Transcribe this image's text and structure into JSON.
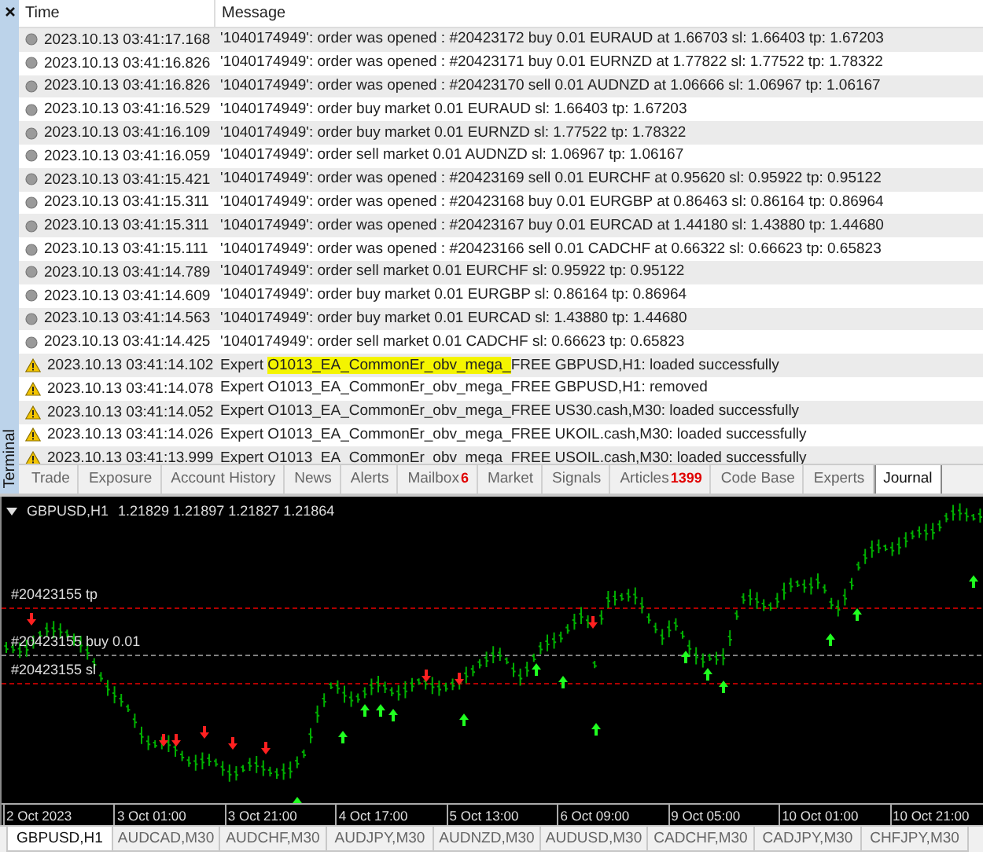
{
  "terminal": {
    "title": "Terminal"
  },
  "journal": {
    "columns": [
      "Time",
      "Message"
    ],
    "rows": [
      {
        "kind": "info",
        "time": "2023.10.13 03:41:17.168",
        "segments": [
          {
            "text": "'1040174949': order was opened : #20423172 buy 0.01 EURAUD at 1.66703 sl: 1.66403 tp: 1.67203",
            "highlighted": false
          }
        ]
      },
      {
        "kind": "info",
        "time": "2023.10.13 03:41:16.826",
        "segments": [
          {
            "text": "'1040174949': order was opened : #20423171 buy 0.01 EURNZD at 1.77822 sl: 1.77522 tp: 1.78322",
            "highlighted": false
          }
        ]
      },
      {
        "kind": "info",
        "time": "2023.10.13 03:41:16.826",
        "segments": [
          {
            "text": "'1040174949': order was opened : #20423170 sell 0.01 AUDNZD at 1.06666 sl: 1.06967 tp: 1.06167",
            "highlighted": false
          }
        ]
      },
      {
        "kind": "info",
        "time": "2023.10.13 03:41:16.529",
        "segments": [
          {
            "text": "'1040174949': order buy market 0.01 EURAUD sl: 1.66403 tp: 1.67203",
            "highlighted": false
          }
        ]
      },
      {
        "kind": "info",
        "time": "2023.10.13 03:41:16.109",
        "segments": [
          {
            "text": "'1040174949': order buy market 0.01 EURNZD sl: 1.77522 tp: 1.78322",
            "highlighted": false
          }
        ]
      },
      {
        "kind": "info",
        "time": "2023.10.13 03:41:16.059",
        "segments": [
          {
            "text": "'1040174949': order sell market 0.01 AUDNZD sl: 1.06967 tp: 1.06167",
            "highlighted": false
          }
        ]
      },
      {
        "kind": "info",
        "time": "2023.10.13 03:41:15.421",
        "segments": [
          {
            "text": "'1040174949': order was opened : #20423169 sell 0.01 EURCHF at 0.95620 sl: 0.95922 tp: 0.95122",
            "highlighted": false
          }
        ]
      },
      {
        "kind": "info",
        "time": "2023.10.13 03:41:15.311",
        "segments": [
          {
            "text": "'1040174949': order was opened : #20423168 buy 0.01 EURGBP at 0.86463 sl: 0.86164 tp: 0.86964",
            "highlighted": false
          }
        ]
      },
      {
        "kind": "info",
        "time": "2023.10.13 03:41:15.311",
        "segments": [
          {
            "text": "'1040174949': order was opened : #20423167 buy 0.01 EURCAD at 1.44180 sl: 1.43880 tp: 1.44680",
            "highlighted": false
          }
        ]
      },
      {
        "kind": "info",
        "time": "2023.10.13 03:41:15.111",
        "segments": [
          {
            "text": "'1040174949': order was opened : #20423166 sell 0.01 CADCHF at 0.66322 sl: 0.66623 tp: 0.65823",
            "highlighted": false
          }
        ]
      },
      {
        "kind": "info",
        "time": "2023.10.13 03:41:14.789",
        "segments": [
          {
            "text": "'1040174949': order sell market 0.01 EURCHF sl: 0.95922 tp: 0.95122",
            "highlighted": false
          }
        ]
      },
      {
        "kind": "info",
        "time": "2023.10.13 03:41:14.609",
        "segments": [
          {
            "text": "'1040174949': order buy market 0.01 EURGBP sl: 0.86164 tp: 0.86964",
            "highlighted": false
          }
        ]
      },
      {
        "kind": "info",
        "time": "2023.10.13 03:41:14.563",
        "segments": [
          {
            "text": "'1040174949': order buy market 0.01 EURCAD sl: 1.43880 tp: 1.44680",
            "highlighted": false
          }
        ]
      },
      {
        "kind": "info",
        "time": "2023.10.13 03:41:14.425",
        "segments": [
          {
            "text": "'1040174949': order sell market 0.01 CADCHF sl: 0.66623 tp: 0.65823",
            "highlighted": false
          }
        ]
      },
      {
        "kind": "warning",
        "time": "2023.10.13 03:41:14.102",
        "segments": [
          {
            "text": "Expert ",
            "highlighted": false
          },
          {
            "text": "O1013_EA_CommonEr_obv_mega_",
            "highlighted": true
          },
          {
            "text": "FREE GBPUSD,H1: loaded successfully",
            "highlighted": false
          }
        ]
      },
      {
        "kind": "warning",
        "time": "2023.10.13 03:41:14.078",
        "segments": [
          {
            "text": "Expert O1013_EA_CommonEr_obv_mega_FREE GBPUSD,H1: removed",
            "highlighted": false
          }
        ]
      },
      {
        "kind": "warning",
        "time": "2023.10.13 03:41:14.052",
        "segments": [
          {
            "text": "Expert O1013_EA_CommonEr_obv_mega_FREE US30.cash,M30: loaded successfully",
            "highlighted": false
          }
        ]
      },
      {
        "kind": "warning",
        "time": "2023.10.13 03:41:14.026",
        "segments": [
          {
            "text": "Expert O1013_EA_CommonEr_obv_mega_FREE UKOIL.cash,M30: loaded successfully",
            "highlighted": false
          }
        ]
      },
      {
        "kind": "warning",
        "time": "2023.10.13 03:41:13.999",
        "segments": [
          {
            "text": "Expert O1013_EA_CommonEr_obv_mega_FREE USOIL.cash,M30: loaded successfully",
            "highlighted": false
          }
        ]
      }
    ]
  },
  "tabs": [
    {
      "label": "Trade",
      "selected": false
    },
    {
      "label": "Exposure",
      "selected": false
    },
    {
      "label": "Account History",
      "selected": false
    },
    {
      "label": "News",
      "selected": false
    },
    {
      "label": "Alerts",
      "selected": false
    },
    {
      "label": "Mailbox",
      "badge": "6",
      "selected": false
    },
    {
      "label": "Market",
      "selected": false
    },
    {
      "label": "Signals",
      "selected": false
    },
    {
      "label": "Articles",
      "badge": "1399",
      "selected": false
    },
    {
      "label": "Code Base",
      "selected": false
    },
    {
      "label": "Experts",
      "selected": false
    },
    {
      "label": "Journal",
      "selected": true
    }
  ],
  "chart": {
    "symbol": "GBPUSD,H1",
    "quote": "1.21829 1.21897 1.21827 1.21864",
    "levels": [
      {
        "kind": "tp",
        "label": "#20423155 tp"
      },
      {
        "kind": "entry",
        "label": "#20423155 buy 0.01"
      },
      {
        "kind": "sl",
        "label": "#20423155 sl"
      }
    ],
    "time_labels": [
      "2 Oct 2023",
      "3 Oct 01:00",
      "3 Oct 21:00",
      "4 Oct 17:00",
      "5 Oct 13:00",
      "6 Oct 09:00",
      "9 Oct 05:00",
      "10 Oct 01:00",
      "10 Oct 21:00"
    ]
  },
  "chart_tabs": [
    {
      "label": "GBPUSD,H1",
      "selected": true
    },
    {
      "label": "AUDCAD,M30",
      "selected": false
    },
    {
      "label": "AUDCHF,M30",
      "selected": false
    },
    {
      "label": "AUDJPY,M30",
      "selected": false
    },
    {
      "label": "AUDNZD,M30",
      "selected": false
    },
    {
      "label": "AUDUSD,M30",
      "selected": false
    },
    {
      "label": "CADCHF,M30",
      "selected": false
    },
    {
      "label": "CADJPY,M30",
      "selected": false
    },
    {
      "label": "CHFJPY,M30",
      "selected": false
    }
  ]
}
